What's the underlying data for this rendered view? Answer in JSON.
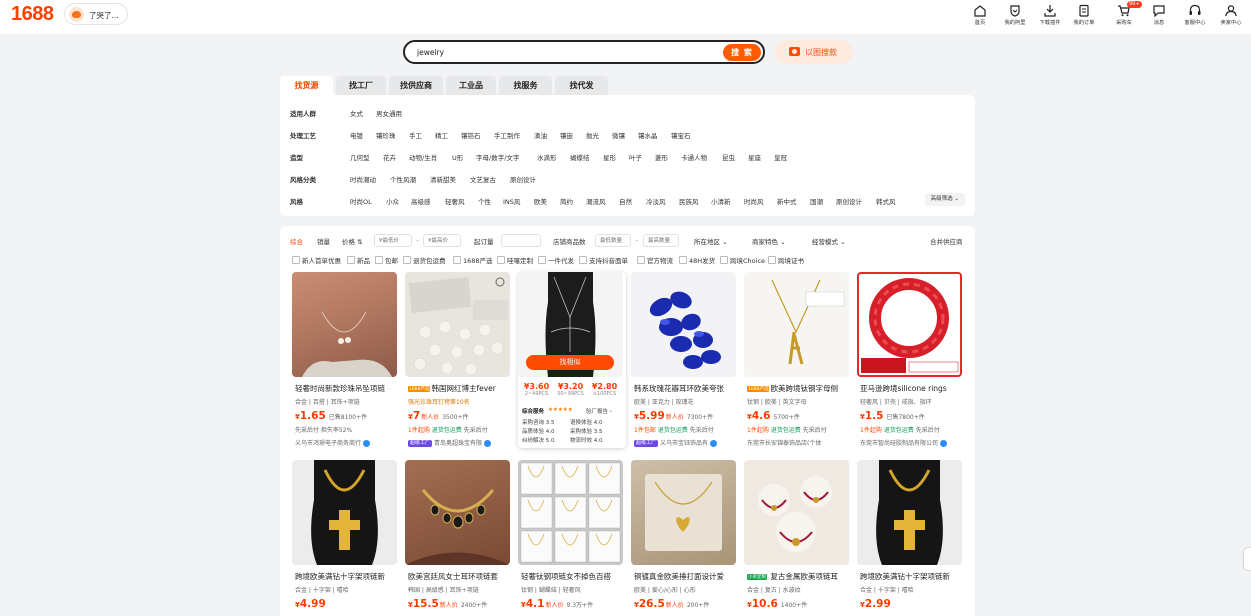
{
  "header": {
    "logo": "1688",
    "shop_name": "了哭了...",
    "nav": [
      {
        "label": "首页",
        "icon": "home-icon"
      },
      {
        "label": "我的阿里",
        "icon": "heart-shield-icon"
      },
      {
        "label": "下载插件",
        "icon": "download-icon"
      },
      {
        "label": "我的订单",
        "icon": "order-icon"
      },
      {
        "label": "采购车",
        "icon": "cart-icon",
        "badge": "99+"
      },
      {
        "label": "消息",
        "icon": "message-icon"
      },
      {
        "label": "客服中心",
        "icon": "headset-icon"
      },
      {
        "label": "卖家中心",
        "icon": "seller-icon"
      }
    ]
  },
  "search": {
    "value": "jewelry",
    "button": "搜 索",
    "image_search": "以图搜款"
  },
  "tabs": [
    {
      "label": "找货源",
      "active": true
    },
    {
      "label": "找工厂"
    },
    {
      "label": "找供应商"
    },
    {
      "label": "工业品"
    },
    {
      "label": "找服务"
    },
    {
      "label": "找代发"
    }
  ],
  "filters": [
    {
      "label": "适用人群",
      "options": [
        "女式",
        "男女通用"
      ]
    },
    {
      "label": "处理工艺",
      "options": [
        "电镀",
        "镶珍珠",
        "手工",
        "精工",
        "镶锆石",
        "手工制作",
        "滴油",
        "镶嵌",
        "抛光",
        "微镶",
        "镶水晶",
        "镶宝石"
      ]
    },
    {
      "label": "造型",
      "options": [
        "几何型",
        "花卉",
        "动物/生肖",
        "U形",
        "字母/数字/文字",
        "水滴形",
        "蝴蝶结",
        "星形",
        "叶子",
        "菱形",
        "卡通人物",
        "昆虫",
        "星座",
        "皇冠"
      ]
    },
    {
      "label": "风格分类",
      "options": [
        "时尚潮动",
        "个性风潮",
        "清新甜美",
        "文艺复古",
        "原创设计"
      ]
    },
    {
      "label": "风格",
      "options": [
        "时尚OL",
        "小众",
        "高级感",
        "轻奢风",
        "个性",
        "INS风",
        "欧美",
        "简约",
        "潮流风",
        "自然",
        "冷淡风",
        "民族风",
        "小清新",
        "时尚风",
        "新中式",
        "国潮",
        "原创设计",
        "韩式风"
      ]
    }
  ],
  "advanced_filter": "高级筛选",
  "sortbar": {
    "items": [
      "综合",
      "销量",
      "价格"
    ],
    "price_min_ph": "¥最低价",
    "price_max_ph": "¥最高价",
    "moq_label": "起订量",
    "shop_goods_label": "店铺商品数",
    "shop_min_ph": "最低数量",
    "shop_max_ph": "最高数量",
    "dropdowns": [
      "所在地区",
      "商家特色",
      "经营模式"
    ],
    "merge": "合并供应商"
  },
  "checkboxes": [
    "新人首单优惠",
    "新品",
    "包邮",
    "退货包运费",
    "1688严选",
    "哇噻定制",
    "一件代发",
    "支持抖音面单",
    "官方物流",
    "48H发货",
    "跨境Choice",
    "跨境证书"
  ],
  "products_row1": [
    {
      "title": "轻奢时尚新款珍珠吊坠项链",
      "tags": "合金 | 百搭 | 耳饰+项链",
      "yen": "¥",
      "price": "1.65",
      "sold": "已售8100+件",
      "perks": "先采后付  担失率52%",
      "seller": "义乌市鸿璟电子商务商行"
    },
    {
      "title": "韩国网红博主fever",
      "tagline": "强光珍珠耳钉榜第10名",
      "yen": "¥",
      "price": "7",
      "newbuyer": "新人价",
      "sold": "3500+件",
      "perk1": "1件起购",
      "perk2": "退货包运费",
      "perk3": "先采后付",
      "seller": "青岛奥超珠宝有限",
      "gold": "超级工厂"
    },
    {
      "popup_btn": "找相似",
      "tiers": [
        {
          "p": "¥3.60",
          "q": "2~49PCS"
        },
        {
          "p": "¥3.20",
          "q": "50~99PCS"
        },
        {
          "p": "¥2.80",
          "q": "≥100PCS"
        }
      ],
      "svc_title": "综合服务",
      "svc_stars": "★★★★★",
      "svc_extra": "验厂报告",
      "svc": [
        "采购咨询 3.5",
        "退换体验 4.0",
        "品质体验 4.0",
        "采购体验 3.5",
        "纠纷解决 5.0",
        "物流时效 4.0"
      ]
    },
    {
      "title": "韩系玫瑰花瓣耳环欧美夸张",
      "tags": "欧美 | 亚克力 | 玫瑰花",
      "yen": "¥",
      "price": "5.99",
      "newbuyer": "新人价",
      "sold": "7300+件",
      "perk1": "1件包邮",
      "perk2": "退货包运费",
      "perk3": "先采后付",
      "seller": "义乌市宝钰饰品有",
      "gold": "超级工厂"
    },
    {
      "title": "欧美跨境钛钢字母侧",
      "tags": "钛钢 | 欧美 | 英文字母",
      "yen": "¥",
      "price": "4.6",
      "sold": "5700+件",
      "perk1": "1件起购",
      "perk2": "退货包运费",
      "perk3": "先采后付",
      "seller": "东莞市长安锦泰饰品店(个体"
    },
    {
      "title": "亚马逊跨境silicone rings",
      "tags": "轻奢风 | 贝壳 | 戒指、指环",
      "yen": "¥",
      "price": "1.5",
      "sold": "已售7800+件",
      "perk1": "1件起购",
      "perk2": "退货包运费",
      "perk3": "先采后付",
      "seller": "东莞市智尚硅胶制品有限公司"
    }
  ],
  "products_row2": [
    {
      "title": "跨境欧美满钻十字架项链新",
      "tags": "合金 | 十字架 | 嘻哈",
      "yen": "¥",
      "price": "4.99"
    },
    {
      "title": "欧美宫廷风女士耳环项链套",
      "tags": "韩国 | 高级感 | 耳饰+项链",
      "yen": "¥",
      "price": "15.5",
      "newbuyer": "新人价",
      "sold": "2400+件"
    },
    {
      "title": "轻奢钛钢项链女不掉色百搭",
      "tags": "钛钢 | 蝴蝶结 | 轻奢风",
      "yen": "¥",
      "price": "4.1",
      "newbuyer": "新人价",
      "sold": "9.3万+件"
    },
    {
      "title": "铜镀真金欧美捶打面设计爱",
      "tags": "欧美 | 爱心/心形 | 心形",
      "yen": "¥",
      "price": "26.5",
      "newbuyer": "新人价",
      "sold": "200+件"
    },
    {
      "title": "复古金属欧美项链耳",
      "tags": "合金 | 复古 | 水波纹",
      "yen": "¥",
      "price": "10.6",
      "sold": "1400+件",
      "badge": "小单定制"
    },
    {
      "title": "跨境欧美满钻十字架项链新",
      "tags": "合金 | 十字架 | 嘻哈",
      "yen": "¥",
      "price": "2.99"
    }
  ],
  "colors": {
    "accent": "#ff4000",
    "tab_bg": "#e7e8ea",
    "page_bg": "#f2f3f5"
  }
}
